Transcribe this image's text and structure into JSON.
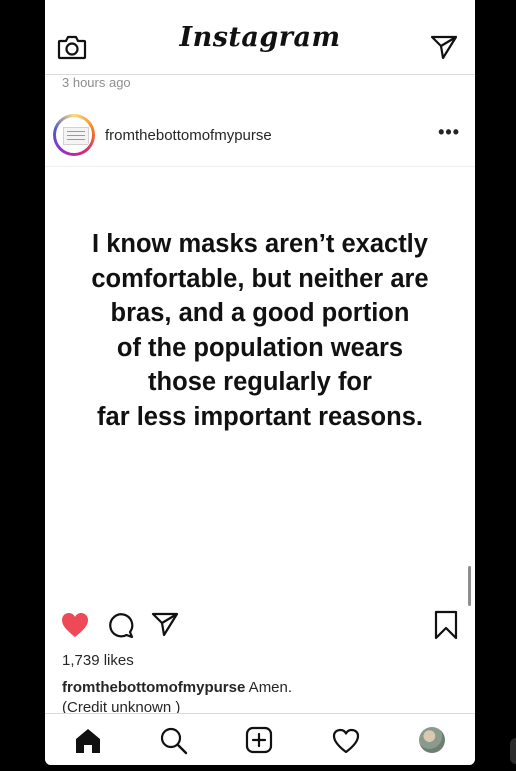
{
  "app": {
    "logo_text": "Instagram"
  },
  "post": {
    "timestamp": "3 hours ago",
    "username": "fromthebottomofmypurse",
    "more_label": "•••",
    "image_text": [
      "I know masks aren’t exactly",
      "comfortable, but neither are",
      "bras, and a good portion",
      "of the population wears",
      "those regularly for",
      "far less important reasons."
    ],
    "likes": "1,739 likes",
    "caption_user": "fromthebottomofmypurse",
    "caption_text": " Amen.",
    "caption_line2": "(Credit unknown )",
    "liked": true
  },
  "icons": {
    "top_left": "camera-icon",
    "top_right": "direct-message-icon",
    "actions": [
      "heart-icon",
      "comment-icon",
      "share-icon",
      "bookmark-icon"
    ],
    "bottom_nav": [
      "home-icon",
      "search-icon",
      "new-post-icon",
      "activity-icon",
      "profile-avatar"
    ]
  },
  "colors": {
    "like_red": "#ed4956",
    "text": "#262626",
    "muted": "#8e8e8e",
    "divider": "#dbdbdb"
  }
}
